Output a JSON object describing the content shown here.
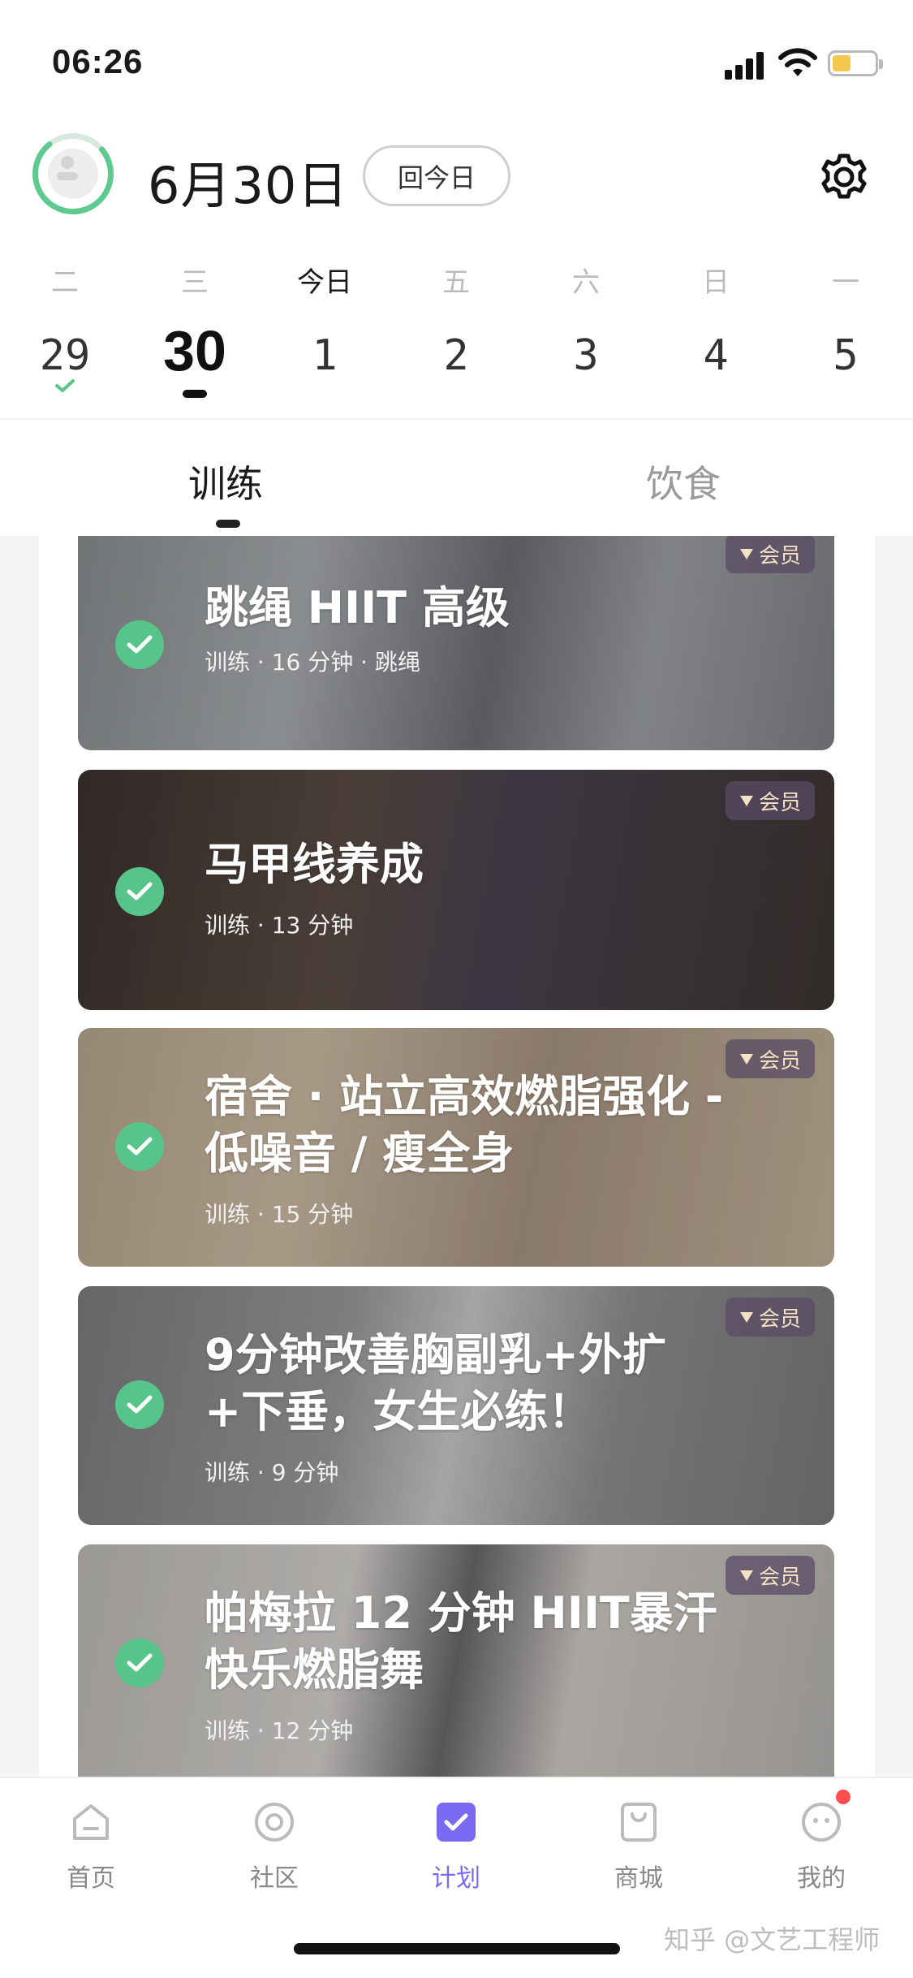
{
  "status_bar": {
    "time": "06:26"
  },
  "header": {
    "date": "6月30日",
    "today_button": "回今日"
  },
  "week": [
    {
      "weekday": "二",
      "day": "29",
      "state": "done"
    },
    {
      "weekday": "三",
      "day": "30",
      "state": "selected"
    },
    {
      "weekday": "今日",
      "day": "1",
      "state": "today"
    },
    {
      "weekday": "五",
      "day": "2",
      "state": ""
    },
    {
      "weekday": "六",
      "day": "3",
      "state": ""
    },
    {
      "weekday": "日",
      "day": "4",
      "state": ""
    },
    {
      "weekday": "一",
      "day": "5",
      "state": ""
    }
  ],
  "tabs": {
    "training": "训练",
    "diet": "饮食"
  },
  "badge_label": "会员",
  "cards": [
    {
      "title": "跳绳 HIIT 高级",
      "subtitle": "训练 · 16 分钟 · 跳绳"
    },
    {
      "title": "马甲线养成",
      "subtitle": "训练 · 13 分钟"
    },
    {
      "title": "宿舍 · 站立高效燃脂强化 - 低噪音 / 瘦全身",
      "subtitle": "训练 · 15 分钟"
    },
    {
      "title": "9分钟改善胸副乳+外扩+下垂，女生必练！",
      "subtitle": "训练 · 9 分钟"
    },
    {
      "title": "帕梅拉 12 分钟 HIIT暴汗快乐燃脂舞",
      "subtitle": "训练 · 12 分钟"
    }
  ],
  "nav": {
    "home": "首页",
    "community": "社区",
    "plan": "计划",
    "mall": "商城",
    "mine": "我的"
  },
  "watermark": "知乎 @文艺工程师",
  "colors": {
    "accent": "#7a6af2",
    "check": "#57c58a",
    "badge_text": "#f3e2c3"
  }
}
